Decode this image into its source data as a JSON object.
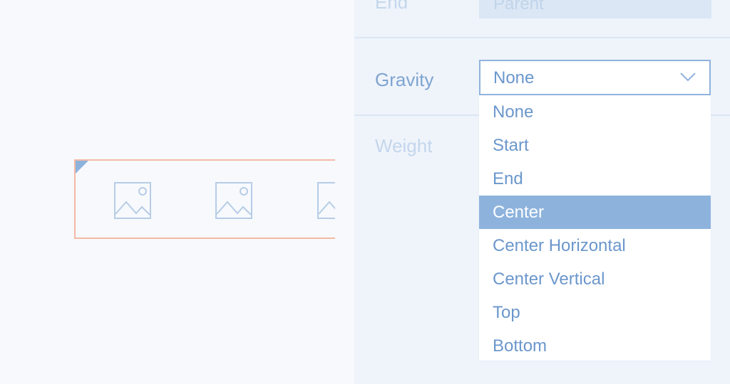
{
  "canvas": {
    "image_placeholders": [
      "image-placeholder-icon",
      "image-placeholder-icon",
      "image-placeholder-icon"
    ]
  },
  "panel": {
    "end_row": {
      "label": "End",
      "value": "Parent"
    },
    "gravity_row": {
      "label": "Gravity",
      "selected": "None",
      "chevron_icon": "chevron-down-icon"
    },
    "weight_row": {
      "label": "Weight"
    },
    "dropdown": {
      "options": [
        "None",
        "Start",
        "End",
        "Center",
        "Center Horizontal",
        "Center Vertical",
        "Top",
        "Bottom"
      ],
      "highlighted": "Center"
    }
  },
  "colors": {
    "accent": "#8db3dd",
    "text": "#6b97cc",
    "selection_border": "#f4b9a6",
    "panel_bg": "#eff4fb",
    "canvas_bg": "#f7f9fd"
  }
}
